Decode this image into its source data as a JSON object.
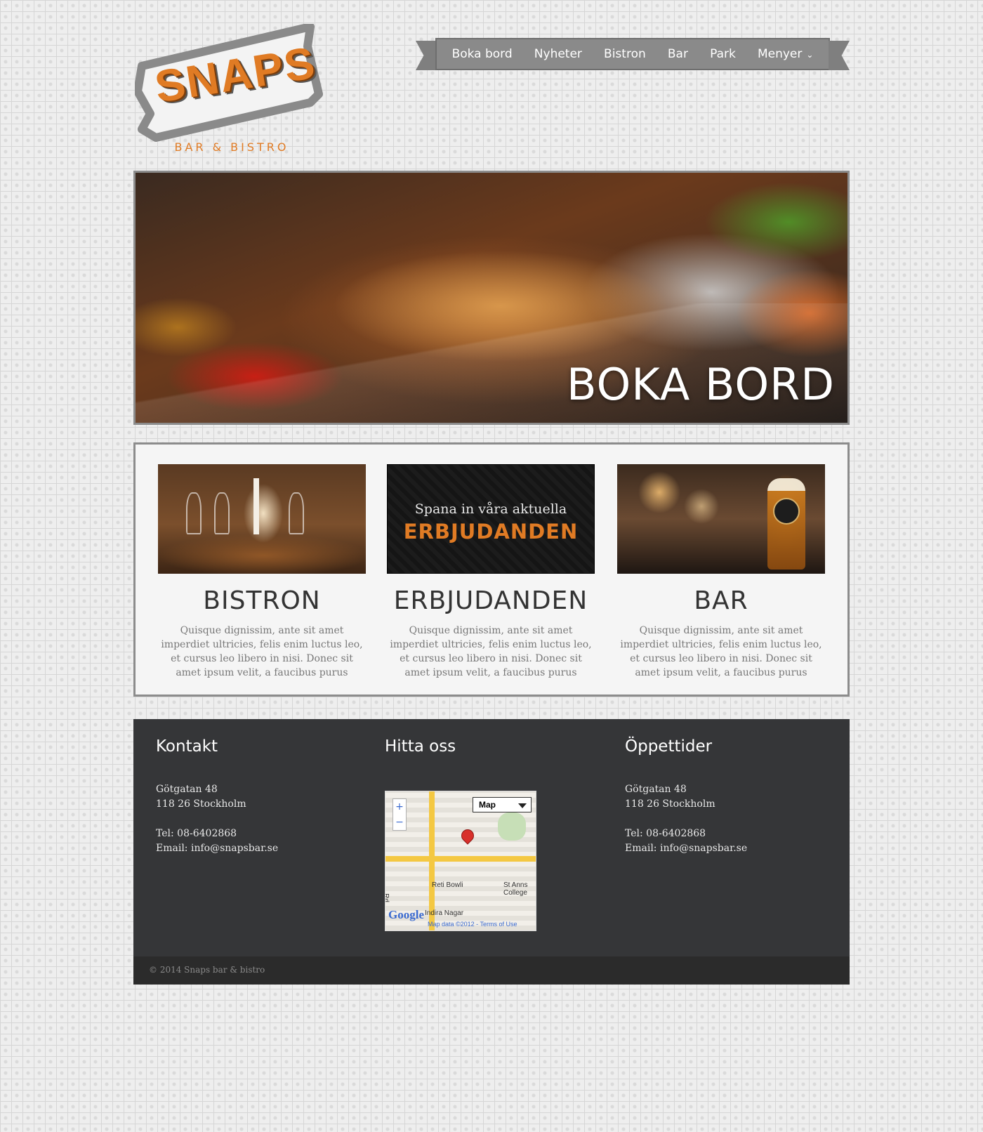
{
  "logo": {
    "word": "SNAPS",
    "tagline": "BAR & BISTRO"
  },
  "nav": {
    "items": [
      {
        "label": "Boka bord"
      },
      {
        "label": "Nyheter"
      },
      {
        "label": "Bistron"
      },
      {
        "label": "Bar"
      },
      {
        "label": "Park"
      },
      {
        "label": "Menyer",
        "icon": "chevron-down-icon"
      }
    ]
  },
  "hero": {
    "title": "BOKA BORD"
  },
  "features": [
    {
      "title": "BISTRON",
      "text": "Quisque dignissim, ante sit amet imperdiet ultricies, felis enim luctus leo, et cursus leo libero in nisi. Donec sit amet ipsum velit, a faucibus purus"
    },
    {
      "title": "ERBJUDANDEN",
      "text": "Quisque dignissim, ante sit amet imperdiet ultricies, felis enim luctus leo, et cursus leo libero in nisi. Donec sit amet ipsum velit, a faucibus purus",
      "banner_line1": "Spana in våra aktuella",
      "banner_line2": "ERBJUDANDEN"
    },
    {
      "title": "BAR",
      "text": "Quisque dignissim, ante sit amet imperdiet ultricies, felis enim luctus leo, et cursus leo libero in nisi. Donec sit amet ipsum velit, a faucibus purus"
    }
  ],
  "footer": {
    "contact": {
      "heading": "Kontakt",
      "street": "Götgatan 48",
      "city": "118 26 Stockholm",
      "phone": "Tel: 08-6402868",
      "email": "Email: info@snapsbar.se"
    },
    "find": {
      "heading": "Hitta oss",
      "map": {
        "type_select": "Map",
        "zoom_in": "+",
        "zoom_out": "−",
        "label_bowling": "Reti Bowli",
        "label_college": "St Anns College",
        "label_area": "Indira Nagar",
        "label_road": "Rd",
        "logo": "Google",
        "attribution": "Map data ©2012 - Terms of Use"
      }
    },
    "hours": {
      "heading": "Öppettider",
      "street": "Götgatan 48",
      "city": "118 26 Stockholm",
      "phone": "Tel: 08-6402868",
      "email": "Email: info@snapsbar.se"
    },
    "copyright": "© 2014 Snaps bar & bistro"
  },
  "colors": {
    "accent": "#e07b24",
    "nav_bg": "#8a8a8a",
    "footer_bg": "#353638",
    "copy_bg": "#2b2b2b"
  }
}
